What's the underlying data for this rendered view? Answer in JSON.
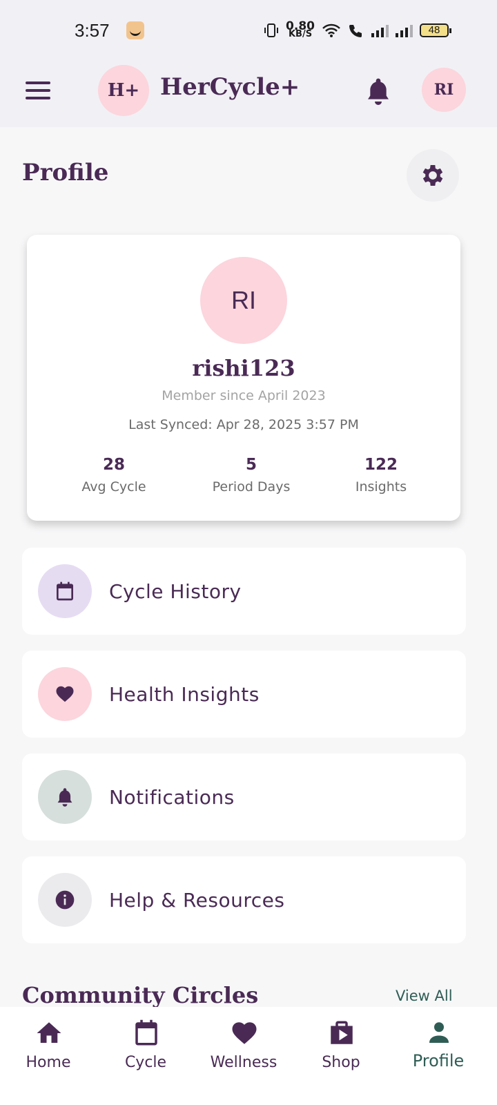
{
  "status_bar": {
    "time": "3:57",
    "net_speed_value": "0.80",
    "net_speed_unit": "KB/S",
    "battery": "48"
  },
  "app_bar": {
    "logo_text": "H+",
    "title": "HerCycle+",
    "avatar_initials": "RI"
  },
  "page": {
    "title": "Profile"
  },
  "profile": {
    "initials": "RI",
    "username": "rishi123",
    "member_since": "Member since April 2023",
    "last_synced": "Last Synced: Apr 28, 2025 3:57 PM",
    "stats": [
      {
        "value": "28",
        "label": "Avg Cycle"
      },
      {
        "value": "5",
        "label": "Period Days"
      },
      {
        "value": "122",
        "label": "Insights"
      }
    ]
  },
  "menu": [
    {
      "label": "Cycle History",
      "icon": "calendar-icon",
      "bg": "#e6dcf2"
    },
    {
      "label": "Health Insights",
      "icon": "heart-icon",
      "bg": "#fcd5dd"
    },
    {
      "label": "Notifications",
      "icon": "bell-icon",
      "bg": "#d6dfdc"
    },
    {
      "label": "Help & Resources",
      "icon": "info-icon",
      "bg": "#ebeaed"
    }
  ],
  "community": {
    "title": "Community Circles",
    "view_all": "View All"
  },
  "bottom_nav": [
    {
      "label": "Home",
      "icon": "home-icon",
      "active": false
    },
    {
      "label": "Cycle",
      "icon": "calendar-icon",
      "active": false
    },
    {
      "label": "Wellness",
      "icon": "heart-icon",
      "active": false
    },
    {
      "label": "Shop",
      "icon": "shop-icon",
      "active": false
    },
    {
      "label": "Profile",
      "icon": "person-icon",
      "active": true
    }
  ],
  "colors": {
    "primary": "#4a2a55",
    "accent_pink": "#fcd5dd",
    "active_nav": "#2f5d55"
  }
}
